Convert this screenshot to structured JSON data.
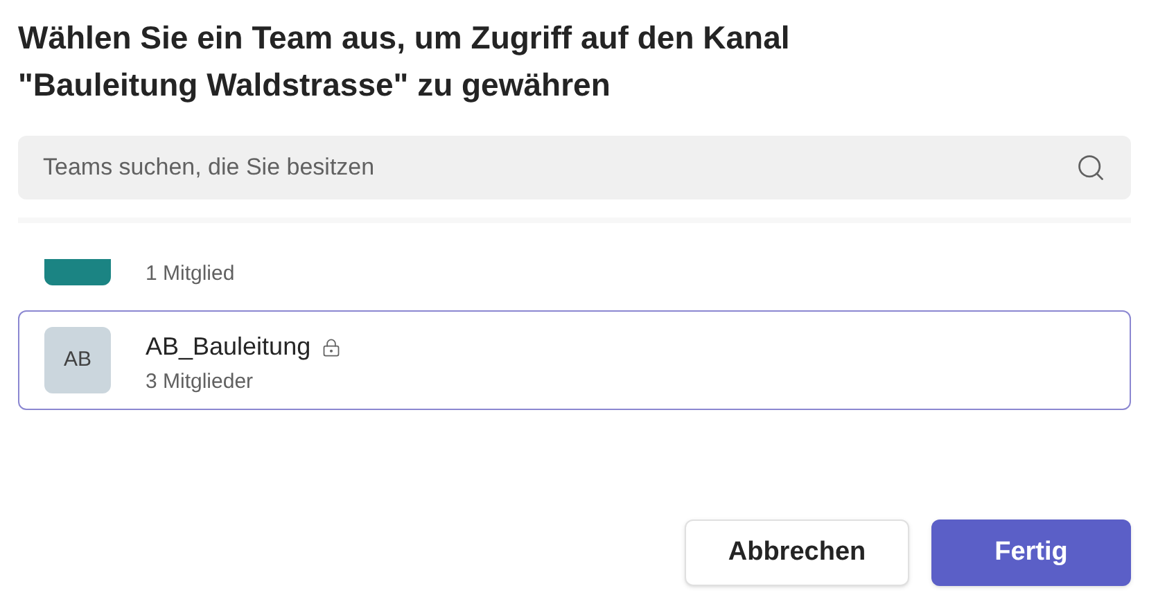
{
  "dialog": {
    "title": "Wählen Sie ein Team aus, um Zugriff auf den Kanal \"Bauleitung Waldstrasse\" zu gewähren"
  },
  "search": {
    "placeholder": "Teams suchen, die Sie besitzen"
  },
  "teams": [
    {
      "members": "1 Mitglied",
      "color": "#1b8483",
      "selected": false
    },
    {
      "initials": "AB",
      "name": "AB_Bauleitung",
      "private": true,
      "members": "3 Mitglieder",
      "color": "#cbd6dd",
      "selected": true
    }
  ],
  "buttons": [
    {
      "label": "Abbrechen",
      "kind": "secondary"
    },
    {
      "label": "Fertig",
      "kind": "primary"
    }
  ]
}
